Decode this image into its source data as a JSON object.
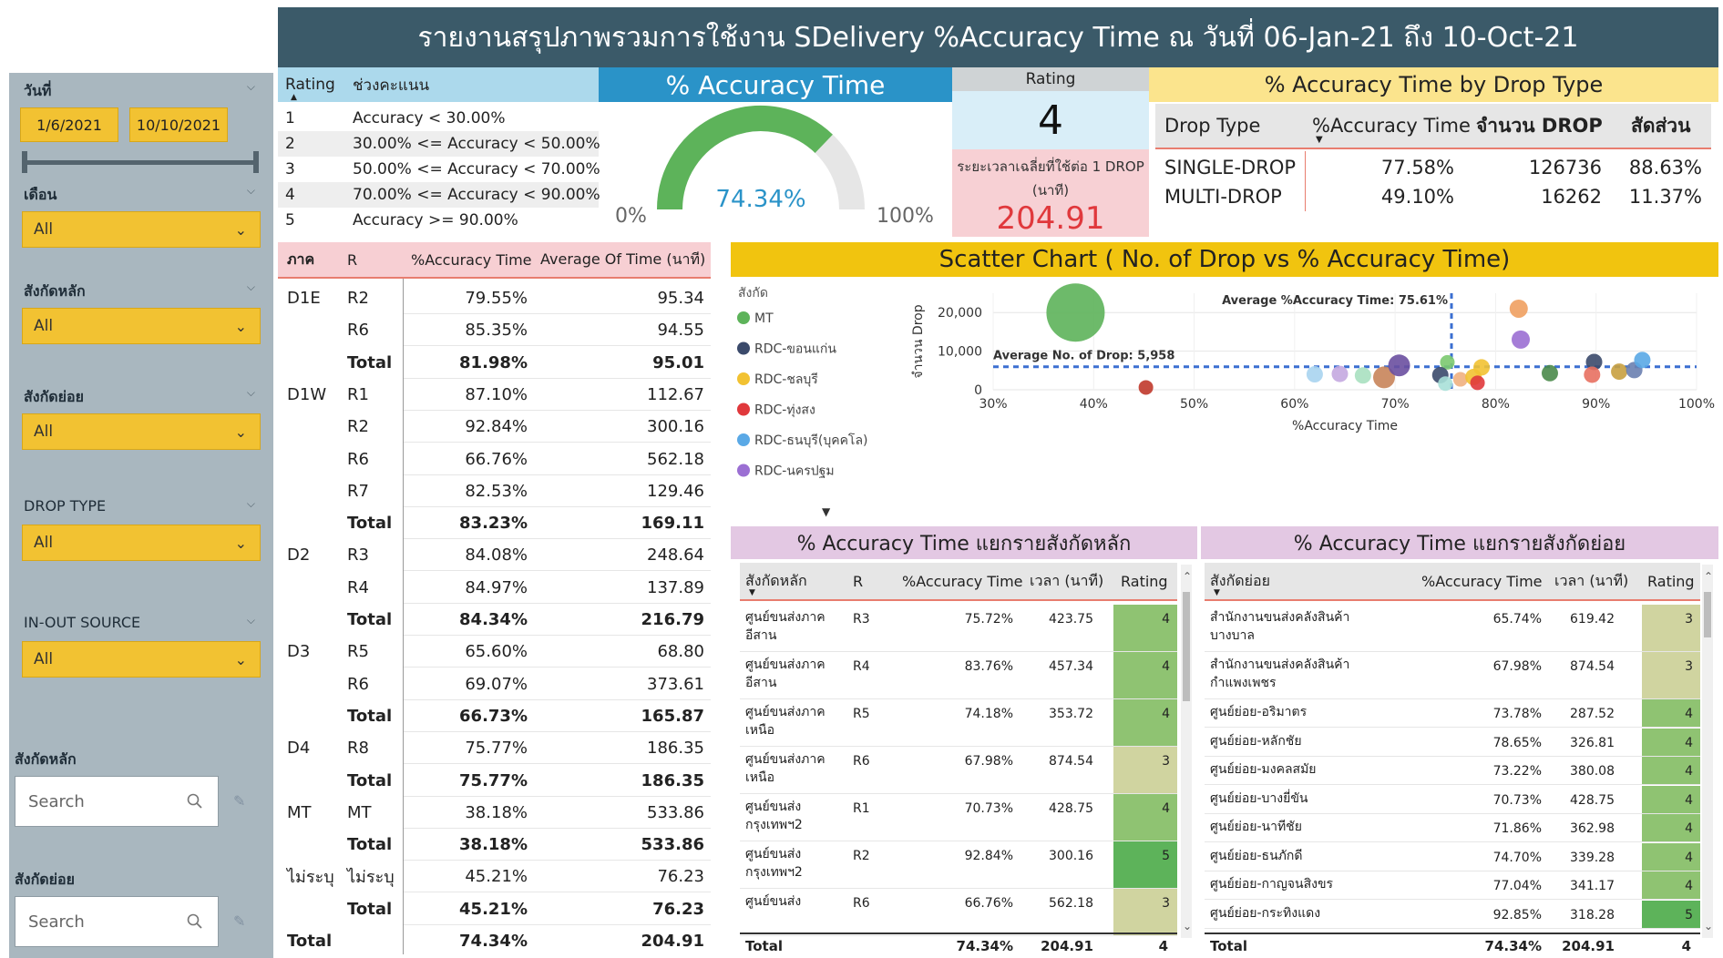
{
  "header": {
    "title": "รายงานสรุปภาพรวมการใช้งาน SDelivery %Accuracy Time ณ วันที่ 06-Jan-21 ถึง 10-Oct-21"
  },
  "sidebar": {
    "date_title": "วันที่",
    "date_from": "1/6/2021",
    "date_to": "10/10/2021",
    "month_title": "เดือน",
    "month_value": "All",
    "main_unit_title": "สังกัดหลัก",
    "main_unit_value": "All",
    "sub_unit_title": "สังกัดย่อย",
    "sub_unit_value": "All",
    "drop_type_title": "DROP TYPE",
    "drop_type_value": "All",
    "inout_title": "IN-OUT SOURCE",
    "inout_value": "All",
    "search_main_title": "สังกัดหลัก",
    "search_main_placeholder": "Search",
    "search_sub_title": "สังกัดย่อย",
    "search_sub_placeholder": "Search"
  },
  "rating_legend": {
    "col_rating": "Rating",
    "col_range": "ช่วงคะแนน",
    "rows": [
      {
        "rating": "1",
        "range": "Accuracy < 30.00%"
      },
      {
        "rating": "2",
        "range": "30.00% <= Accuracy < 50.00%"
      },
      {
        "rating": "3",
        "range": "50.00% <= Accuracy < 70.00%"
      },
      {
        "rating": "4",
        "range": "70.00% <= Accuracy < 90.00%"
      },
      {
        "rating": "5",
        "range": "Accuracy >= 90.00%"
      }
    ]
  },
  "gauge": {
    "title": "% Accuracy Time",
    "value": 74.34,
    "value_label": "74.34%",
    "min_label": "0%",
    "max_label": "100%",
    "colors": {
      "fill": "#5db35a",
      "track": "#e6e6e6",
      "value_text": "#2a93c8"
    }
  },
  "rating_card": {
    "title": "Rating",
    "value": "4",
    "sub_label": "ระยะเวลาเฉลี่ยที่ใช้ต่อ 1 DROP (นาที)",
    "sub_value": "204.91"
  },
  "drop_type": {
    "title": "% Accuracy Time by Drop Type",
    "col_type": "Drop Type",
    "col_acc": "%Accuracy Time",
    "col_count": "จำนวน DROP",
    "col_share": "สัดส่วน",
    "rows": [
      {
        "type": "SINGLE-DROP",
        "acc": "77.58%",
        "count": "126736",
        "share": "88.63%"
      },
      {
        "type": "MULTI-DROP",
        "acc": "49.10%",
        "count": "16262",
        "share": "11.37%"
      }
    ]
  },
  "region_table": {
    "col_region": "ภาค",
    "col_r": "R",
    "col_acc": "%Accuracy Time",
    "col_avg": "Average Of Time (นาที)",
    "rows": [
      {
        "region": "D1E",
        "r": "R2",
        "acc": "79.55%",
        "avg": "95.34"
      },
      {
        "region": "",
        "r": "R6",
        "acc": "85.35%",
        "avg": "94.55"
      },
      {
        "region": "",
        "r": "Total",
        "acc": "81.98%",
        "avg": "95.01",
        "total": true
      },
      {
        "region": "D1W",
        "r": "R1",
        "acc": "87.10%",
        "avg": "112.67"
      },
      {
        "region": "",
        "r": "R2",
        "acc": "92.84%",
        "avg": "300.16"
      },
      {
        "region": "",
        "r": "R6",
        "acc": "66.76%",
        "avg": "562.18"
      },
      {
        "region": "",
        "r": "R7",
        "acc": "82.53%",
        "avg": "129.46"
      },
      {
        "region": "",
        "r": "Total",
        "acc": "83.23%",
        "avg": "169.11",
        "total": true
      },
      {
        "region": "D2",
        "r": "R3",
        "acc": "84.08%",
        "avg": "248.64"
      },
      {
        "region": "",
        "r": "R4",
        "acc": "84.97%",
        "avg": "137.89"
      },
      {
        "region": "",
        "r": "Total",
        "acc": "84.34%",
        "avg": "216.79",
        "total": true
      },
      {
        "region": "D3",
        "r": "R5",
        "acc": "65.60%",
        "avg": "68.80"
      },
      {
        "region": "",
        "r": "R6",
        "acc": "69.07%",
        "avg": "373.61"
      },
      {
        "region": "",
        "r": "Total",
        "acc": "66.73%",
        "avg": "165.87",
        "total": true
      },
      {
        "region": "D4",
        "r": "R8",
        "acc": "75.77%",
        "avg": "186.35"
      },
      {
        "region": "",
        "r": "Total",
        "acc": "75.77%",
        "avg": "186.35",
        "total": true
      },
      {
        "region": "MT",
        "r": "MT",
        "acc": "38.18%",
        "avg": "533.86"
      },
      {
        "region": "",
        "r": "Total",
        "acc": "38.18%",
        "avg": "533.86",
        "total": true
      },
      {
        "region": "ไม่ระบุ",
        "r": "ไม่ระบุ",
        "acc": "45.21%",
        "avg": "76.23"
      },
      {
        "region": "",
        "r": "Total",
        "acc": "45.21%",
        "avg": "76.23",
        "total": true
      },
      {
        "region": "Total",
        "r": "",
        "acc": "74.34%",
        "avg": "204.91",
        "total": true
      }
    ]
  },
  "chart_data": {
    "type": "scatter",
    "title": "Scatter Chart ( No. of Drop vs % Accuracy Time)",
    "xlabel": "%Accuracy Time",
    "ylabel": "จำนวน Drop",
    "xlim": [
      30,
      100
    ],
    "ylim": [
      0,
      25000
    ],
    "x_ticks": [
      "30%",
      "40%",
      "50%",
      "60%",
      "70%",
      "80%",
      "90%",
      "100%"
    ],
    "y_ticks": [
      "0",
      "10,000",
      "20,000"
    ],
    "legend_title": "สังกัด",
    "legend": [
      {
        "name": "MT",
        "color": "#5db35a"
      },
      {
        "name": "RDC-ขอนแก่น",
        "color": "#3b4a6b"
      },
      {
        "name": "RDC-ชลบุรี",
        "color": "#f2c232"
      },
      {
        "name": "RDC-ทุ่งสง",
        "color": "#e0383c"
      },
      {
        "name": "RDC-ธนบุรี(บุคคโล)",
        "color": "#5aa9e6"
      },
      {
        "name": "RDC-นครปฐม",
        "color": "#9b6fd3"
      }
    ],
    "ref_x": {
      "value": 75.61,
      "label": "Average %Accuracy Time: 75.61%"
    },
    "ref_y": {
      "value": 5958,
      "label": "Average No. of Drop: 5,958"
    },
    "points": [
      {
        "x": 38.2,
        "y": 20000,
        "size": 32,
        "color": "#5db35a"
      },
      {
        "x": 45.2,
        "y": 600,
        "size": 8,
        "color": "#c0392b"
      },
      {
        "x": 62.0,
        "y": 4000,
        "size": 9,
        "color": "#a8d4f0"
      },
      {
        "x": 64.5,
        "y": 4100,
        "size": 9,
        "color": "#c4a8e0"
      },
      {
        "x": 66.8,
        "y": 3700,
        "size": 9,
        "color": "#a8e0c0"
      },
      {
        "x": 68.9,
        "y": 3200,
        "size": 12,
        "color": "#c8845a"
      },
      {
        "x": 70.4,
        "y": 6300,
        "size": 12,
        "color": "#6a4fa0"
      },
      {
        "x": 75.2,
        "y": 7100,
        "size": 8,
        "color": "#7bc96f"
      },
      {
        "x": 74.5,
        "y": 3800,
        "size": 9,
        "color": "#3b4a6b"
      },
      {
        "x": 75.0,
        "y": 1600,
        "size": 8,
        "color": "#a8e0d8"
      },
      {
        "x": 76.5,
        "y": 2700,
        "size": 8,
        "color": "#f0b080"
      },
      {
        "x": 77.8,
        "y": 3300,
        "size": 9,
        "color": "#f2c232"
      },
      {
        "x": 78.6,
        "y": 5800,
        "size": 9,
        "color": "#f2c232"
      },
      {
        "x": 78.2,
        "y": 1800,
        "size": 8,
        "color": "#e0383c"
      },
      {
        "x": 82.3,
        "y": 21000,
        "size": 10,
        "color": "#f0a060"
      },
      {
        "x": 82.5,
        "y": 13000,
        "size": 10,
        "color": "#9b6fd3"
      },
      {
        "x": 85.4,
        "y": 4300,
        "size": 9,
        "color": "#4a8a4a"
      },
      {
        "x": 89.8,
        "y": 7200,
        "size": 9,
        "color": "#3b4a6b"
      },
      {
        "x": 89.6,
        "y": 3900,
        "size": 9,
        "color": "#e87060"
      },
      {
        "x": 92.3,
        "y": 4700,
        "size": 9,
        "color": "#c8a040"
      },
      {
        "x": 93.8,
        "y": 5100,
        "size": 9,
        "color": "#6a80b0"
      },
      {
        "x": 94.6,
        "y": 7700,
        "size": 9,
        "color": "#5aa9e6"
      }
    ]
  },
  "main_unit_table": {
    "title": "% Accuracy Time แยกรายสังกัดหลัก",
    "col_unit": "สังกัดหลัก",
    "col_r": "R",
    "col_acc": "%Accuracy Time",
    "col_time": "เวลา (นาที)",
    "col_rating": "Rating",
    "rows": [
      {
        "unit1": "ศูนย์ขนส่งภาค",
        "unit2": "อีสาน",
        "r": "R3",
        "acc": "75.72%",
        "time": "423.75",
        "rating": "4",
        "color": "#8fc372"
      },
      {
        "unit1": "ศูนย์ขนส่งภาค",
        "unit2": "อีสาน",
        "r": "R4",
        "acc": "83.76%",
        "time": "457.34",
        "rating": "4",
        "color": "#8fc372"
      },
      {
        "unit1": "ศูนย์ขนส่งภาค",
        "unit2": "เหนือ",
        "r": "R5",
        "acc": "74.18%",
        "time": "353.72",
        "rating": "4",
        "color": "#8fc372"
      },
      {
        "unit1": "ศูนย์ขนส่งภาค",
        "unit2": "เหนือ",
        "r": "R6",
        "acc": "67.98%",
        "time": "874.54",
        "rating": "3",
        "color": "#d0d4a0"
      },
      {
        "unit1": "ศูนย์ขนส่ง",
        "unit2": "กรุงเทพฯ2",
        "r": "R1",
        "acc": "70.73%",
        "time": "428.75",
        "rating": "4",
        "color": "#8fc372"
      },
      {
        "unit1": "ศูนย์ขนส่ง",
        "unit2": "กรุงเทพฯ2",
        "r": "R2",
        "acc": "92.84%",
        "time": "300.16",
        "rating": "5",
        "color": "#5db35a"
      },
      {
        "unit1": "ศูนย์ขนส่ง",
        "unit2": "",
        "r": "R6",
        "acc": "66.76%",
        "time": "562.18",
        "rating": "3",
        "color": "#d0d4a0"
      }
    ],
    "total": {
      "label": "Total",
      "acc": "74.34%",
      "time": "204.91",
      "rating": "4"
    }
  },
  "sub_unit_table": {
    "title": "% Accuracy Time แยกรายสังกัดย่อย",
    "col_unit": "สังกัดย่อย",
    "col_acc": "%Accuracy Time",
    "col_time": "เวลา (นาที)",
    "col_rating": "Rating",
    "rows": [
      {
        "unit1": "สำนักงานขนส่งคลังสินค้า",
        "unit2": "บางบาล",
        "acc": "65.74%",
        "time": "619.42",
        "rating": "3",
        "color": "#d0d4a0"
      },
      {
        "unit1": "สำนักงานขนส่งคลังสินค้า",
        "unit2": "กำแพงเพชร",
        "acc": "67.98%",
        "time": "874.54",
        "rating": "3",
        "color": "#d0d4a0"
      },
      {
        "unit1": "ศูนย์ย่อย-อริมาตร",
        "unit2": "",
        "acc": "73.78%",
        "time": "287.52",
        "rating": "4",
        "color": "#8fc372"
      },
      {
        "unit1": "ศูนย์ย่อย-หลักชัย",
        "unit2": "",
        "acc": "78.65%",
        "time": "326.81",
        "rating": "4",
        "color": "#8fc372"
      },
      {
        "unit1": "ศูนย์ย่อย-มงคลสมัย",
        "unit2": "",
        "acc": "73.22%",
        "time": "380.08",
        "rating": "4",
        "color": "#8fc372"
      },
      {
        "unit1": "ศูนย์ย่อย-บางยี่ขัน",
        "unit2": "",
        "acc": "70.73%",
        "time": "428.75",
        "rating": "4",
        "color": "#8fc372"
      },
      {
        "unit1": "ศูนย์ย่อย-นาทีชัย",
        "unit2": "",
        "acc": "71.86%",
        "time": "362.98",
        "rating": "4",
        "color": "#8fc372"
      },
      {
        "unit1": "ศูนย์ย่อย-ธนภักดี",
        "unit2": "",
        "acc": "74.70%",
        "time": "339.28",
        "rating": "4",
        "color": "#8fc372"
      },
      {
        "unit1": "ศูนย์ย่อย-กาญจนสิงขร",
        "unit2": "",
        "acc": "77.04%",
        "time": "341.17",
        "rating": "4",
        "color": "#8fc372"
      },
      {
        "unit1": "ศูนย์ย่อย-กระทิงแดง",
        "unit2": "",
        "acc": "92.85%",
        "time": "318.28",
        "rating": "5",
        "color": "#5db35a"
      }
    ],
    "total": {
      "label": "Total",
      "acc": "74.34%",
      "time": "204.91",
      "rating": "4"
    }
  }
}
